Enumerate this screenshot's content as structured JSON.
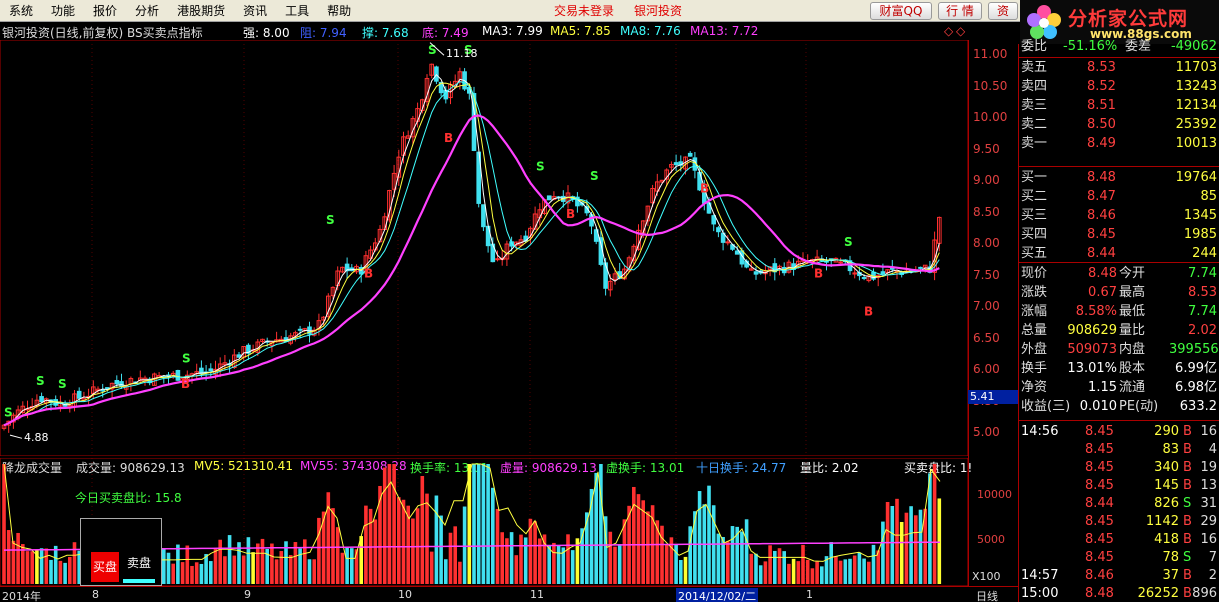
{
  "menu": {
    "items": [
      "系统",
      "功能",
      "报价",
      "分析",
      "港股期货",
      "资讯",
      "工具",
      "帮助"
    ],
    "status_login": "交易未登录",
    "status_broker": "银河投资",
    "btn_qq": "财富QQ",
    "btn_quote": "行 情",
    "btn_asset": "资"
  },
  "logo": {
    "title": "分析家公式网",
    "url": "www.88gs.com"
  },
  "title_row": {
    "name": "银河投资(日线,前复权) BS买卖点指标",
    "strong_label": "强: 8.00",
    "resist_label": "阻: 7.94",
    "support_label": "撑: 7.68",
    "bottom_label": "底: 7.49",
    "ma3": "MA3: 7.99",
    "ma5": "MA5: 7.85",
    "ma8": "MA8: 7.76",
    "ma13": "MA13: 7.72"
  },
  "annotations": {
    "high": "11.18",
    "low": "4.88"
  },
  "vol_header": {
    "name": "降龙成交量",
    "vol": "成交量: 908629.13",
    "mv5": "MV5: 521310.41",
    "mv55": "MV55: 374308.28",
    "turnover": "换手率: 13.01",
    "virtual_vol": "虚量: 908629.13",
    "virtual_turnover": "虚换手: 13.01",
    "ten_day_turnover": "十日换手: 24.77",
    "vol_ratio": "量比: 2.02",
    "bs_ratio": "买卖盘比: 1!"
  },
  "buysell": {
    "label": "今日买卖盘比: 15.8",
    "buy": "买盘",
    "sell": "卖盘"
  },
  "x_axis": {
    "labels": [
      "2014年",
      "8",
      "9",
      "10",
      "11",
      "2014/12/02/二",
      "1"
    ],
    "right_label": "日线",
    "scale": "X100"
  },
  "price_marker": "5.41",
  "y_axis": {
    "price_ticks": [
      "11.00",
      "10.50",
      "10.00",
      "9.50",
      "9.00",
      "8.50",
      "8.00",
      "7.50",
      "7.00",
      "6.50",
      "6.00",
      "5.50",
      "5.00"
    ],
    "vol_ticks": [
      "10000",
      "5000"
    ]
  },
  "right_panel": {
    "top_partial": {
      "label": "委比",
      "value": "-51.16%",
      "label2": "委差",
      "value2": "-49062"
    },
    "sells": [
      {
        "label": "卖五",
        "price": "8.53",
        "vol": "11703"
      },
      {
        "label": "卖四",
        "price": "8.52",
        "vol": "13243"
      },
      {
        "label": "卖三",
        "price": "8.51",
        "vol": "12134"
      },
      {
        "label": "卖二",
        "price": "8.50",
        "vol": "25392"
      },
      {
        "label": "卖一",
        "price": "8.49",
        "vol": "10013"
      }
    ],
    "buys": [
      {
        "label": "买一",
        "price": "8.48",
        "vol": "19764"
      },
      {
        "label": "买二",
        "price": "8.47",
        "vol": "85"
      },
      {
        "label": "买三",
        "price": "8.46",
        "vol": "1345"
      },
      {
        "label": "买四",
        "price": "8.45",
        "vol": "1985"
      },
      {
        "label": "买五",
        "price": "8.44",
        "vol": "244"
      }
    ],
    "stats": [
      {
        "l1": "现价",
        "v1": "8.48",
        "c1": "red",
        "l2": "今开",
        "v2": "7.74",
        "c2": "green"
      },
      {
        "l1": "涨跌",
        "v1": "0.67",
        "c1": "red",
        "l2": "最高",
        "v2": "8.53",
        "c2": "red"
      },
      {
        "l1": "涨幅",
        "v1": "8.58%",
        "c1": "red",
        "l2": "最低",
        "v2": "7.74",
        "c2": "green"
      },
      {
        "l1": "总量",
        "v1": "908629",
        "c1": "yellow",
        "l2": "量比",
        "v2": "2.02",
        "c2": "red"
      },
      {
        "l1": "外盘",
        "v1": "509073",
        "c1": "red",
        "l2": "内盘",
        "v2": "399556",
        "c2": "green"
      },
      {
        "l1": "换手",
        "v1": "13.01%",
        "c1": "white",
        "l2": "股本",
        "v2": "6.99亿",
        "c2": "white"
      },
      {
        "l1": "净资",
        "v1": "1.15",
        "c1": "white",
        "l2": "流通",
        "v2": "6.98亿",
        "c2": "white"
      },
      {
        "l1": "收益(三)",
        "v1": "0.010",
        "c1": "white",
        "l2": "PE(动)",
        "v2": "633.2",
        "c2": "white"
      }
    ],
    "ticks": [
      {
        "time": "14:56",
        "price": "8.45",
        "vol": "290",
        "side": "B",
        "n": "16"
      },
      {
        "time": "",
        "price": "8.45",
        "vol": "83",
        "side": "B",
        "n": "4"
      },
      {
        "time": "",
        "price": "8.45",
        "vol": "340",
        "side": "B",
        "n": "19"
      },
      {
        "time": "",
        "price": "8.45",
        "vol": "145",
        "side": "B",
        "n": "13"
      },
      {
        "time": "",
        "price": "8.44",
        "vol": "826",
        "side": "S",
        "n": "31"
      },
      {
        "time": "",
        "price": "8.45",
        "vol": "1142",
        "side": "B",
        "n": "29"
      },
      {
        "time": "",
        "price": "8.45",
        "vol": "418",
        "side": "B",
        "n": "16"
      },
      {
        "time": "",
        "price": "8.45",
        "vol": "78",
        "side": "S",
        "n": "7"
      },
      {
        "time": "14:57",
        "price": "8.46",
        "vol": "37",
        "side": "B",
        "n": "2"
      },
      {
        "time": "15:00",
        "price": "8.48",
        "vol": "26252",
        "side": "B",
        "n": "896"
      }
    ]
  },
  "colors": {
    "up": "#ff3030",
    "down": "#40e0f0",
    "ma3": "#ffffff",
    "ma5": "#ffff40",
    "ma8": "#40ffff",
    "ma13": "#ff40ff"
  }
}
